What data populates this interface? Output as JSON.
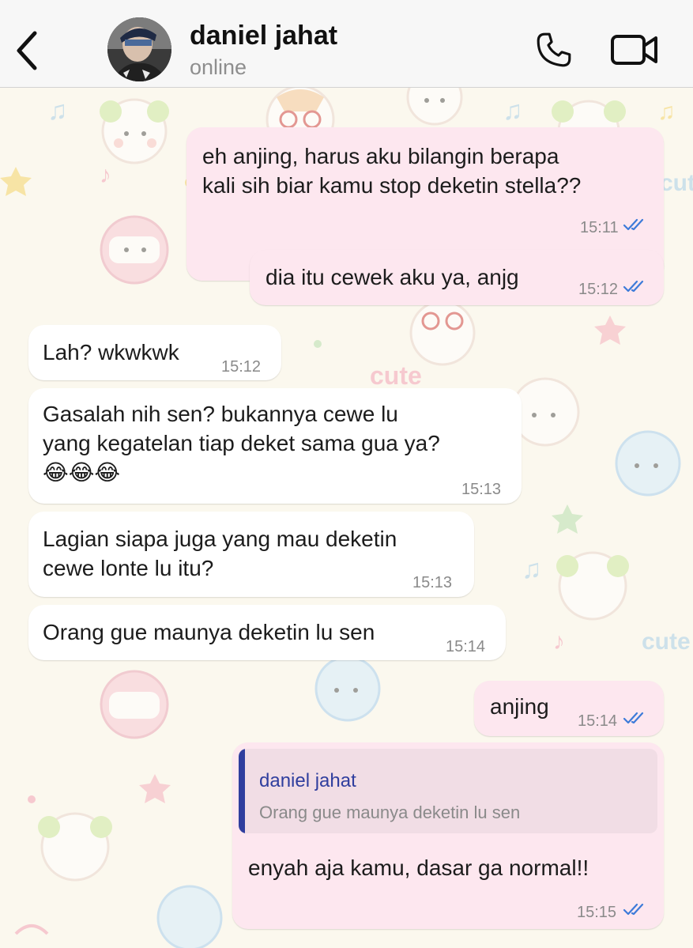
{
  "header": {
    "contact_name": "daniel jahat",
    "status": "online",
    "back_icon": "chevron-left-icon",
    "call_icon": "phone-icon",
    "video_icon": "video-camera-icon"
  },
  "colors": {
    "outgoing_bubble": "#fde7ef",
    "incoming_bubble": "#ffffff",
    "read_tick": "#3d7bd9",
    "quote_accent": "#2f3e9e"
  },
  "messages": [
    {
      "direction": "out",
      "lines": [
        "eh anjing, harus aku bilangin berapa",
        "kali sih biar kamu stop deketin stella??"
      ],
      "time": "15:11",
      "status": "read"
    },
    {
      "direction": "out",
      "lines": [
        "dia itu cewek aku ya, anjg"
      ],
      "time": "15:12",
      "status": "read"
    },
    {
      "direction": "in",
      "lines": [
        "Lah? wkwkwk"
      ],
      "time": "15:12"
    },
    {
      "direction": "in",
      "lines": [
        "Gasalah nih sen? bukannya cewe lu",
        "yang kegatelan tiap deket sama gua ya?",
        "😂😂😂"
      ],
      "time": "15:13"
    },
    {
      "direction": "in",
      "lines": [
        "Lagian siapa juga yang mau deketin",
        "cewe lonte lu itu?"
      ],
      "time": "15:13"
    },
    {
      "direction": "in",
      "lines": [
        "Orang gue maunya deketin lu sen"
      ],
      "time": "15:14"
    },
    {
      "direction": "out",
      "lines": [
        "anjing"
      ],
      "time": "15:14",
      "status": "read"
    },
    {
      "direction": "out",
      "reply_to": {
        "author": "daniel jahat",
        "text": "Orang gue maunya deketin lu sen"
      },
      "lines": [
        "enyah aja kamu, dasar ga normal!!"
      ],
      "time": "15:15",
      "status": "read"
    }
  ]
}
